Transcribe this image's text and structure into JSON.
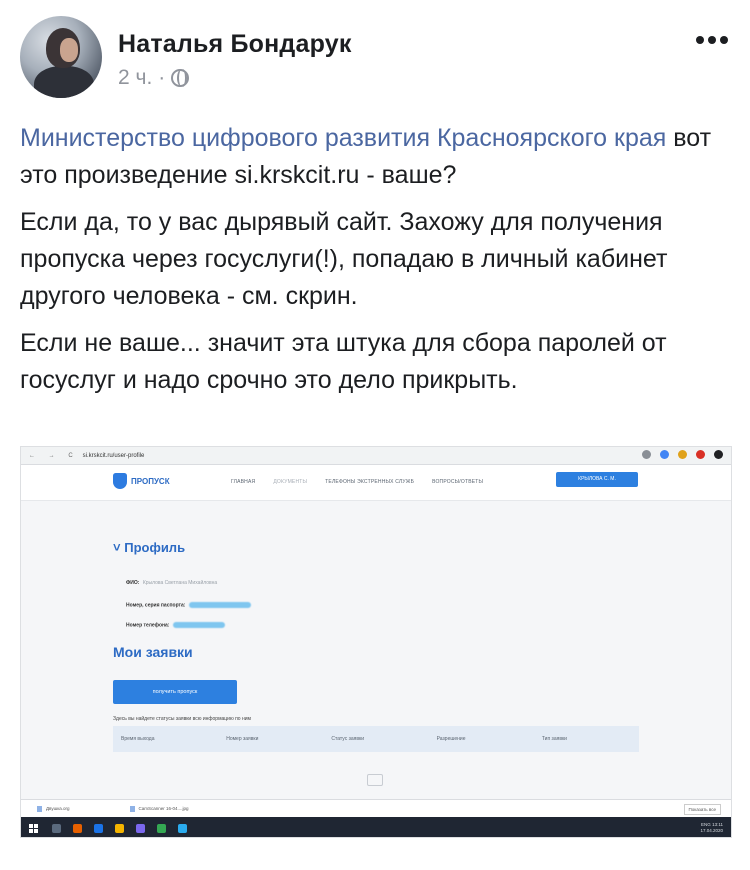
{
  "post": {
    "author": "Наталья Бондарук",
    "time": "2 ч.",
    "separator": "·",
    "mention": "Министерство цифрового развития Красноярского края",
    "line1_rest": " вот это произведение si.krskcit.ru - ваше?",
    "para2": "Если да, то у вас дырявый сайт. Захожу для получения пропуска через госуслуги(!), попадаю в личный кабинет другого человека - см. скрин.",
    "para3": "Если не ваше... значит эта штука для сбора паролей от госуслуг и надо срочно это дело прикрыть."
  },
  "icons": {
    "avatar": "author-avatar",
    "privacy": "globe-icon",
    "more": "more-options-icon"
  },
  "screenshot": {
    "url": "si.krskcit.ru/user-profile",
    "nav_arrows": "← → C",
    "logo": "ПРОПУСК",
    "menu": [
      "ГЛАВНАЯ",
      "ДОКУМЕНТЫ",
      "ТЕЛЕФОНЫ ЭКСТРЕННЫХ СЛУЖБ",
      "ВОПРОСЫ/ОТВЕТЫ"
    ],
    "user_button": "КРЫЛОВА С. М.",
    "profile_title": "Профиль",
    "fio_label": "ФИО:",
    "fio_value": "Крылова Светлана Михайловна",
    "passport_label": "Номер, серия паспорта:",
    "phone_label": "Номер телефона:",
    "orders_title": "Мои заявки",
    "get_pass_button": "получить пропуск",
    "hint": "Здесь вы найдете статусы заявки всю информацию по ним",
    "table_headers": [
      "Время выхода",
      "Номер заявки",
      "Статус заявки",
      "Разрешение",
      "Тип заявки"
    ],
    "downloads": [
      "Двушка.org",
      "CamScanner 16-04....jpg"
    ],
    "show_all": "Показать все",
    "tray_time": "13:11",
    "tray_date": "17.04.2020",
    "tray_lang": "ENG"
  },
  "colors": {
    "mention": "#4b67a1",
    "site_blue": "#2d80e0",
    "taskbar": "#1f2633"
  }
}
